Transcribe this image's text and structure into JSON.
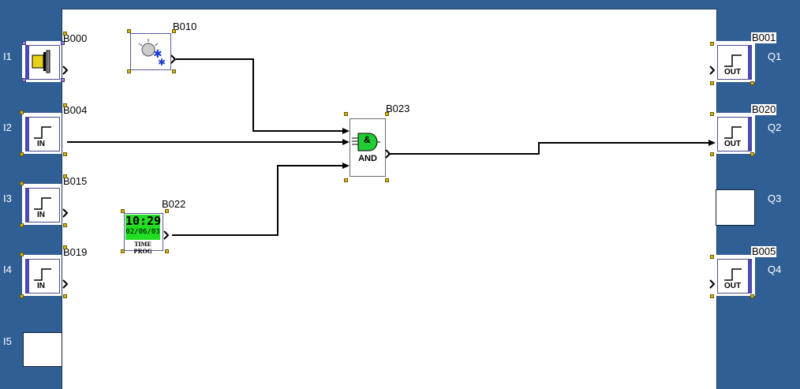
{
  "inputs": [
    {
      "label": "I1",
      "block_id": "B000",
      "symbol": "pushbutton-icon"
    },
    {
      "label": "I2",
      "block_id": "B004",
      "symbol_text": "IN"
    },
    {
      "label": "I3",
      "block_id": "B015",
      "symbol_text": "IN"
    },
    {
      "label": "I4",
      "block_id": "B019",
      "symbol_text": "IN"
    },
    {
      "label": "I5",
      "block_id": ""
    }
  ],
  "outputs": [
    {
      "label": "Q1",
      "block_id": "B001",
      "symbol_text": "OUT"
    },
    {
      "label": "Q2",
      "block_id": "B020",
      "symbol_text": "OUT"
    },
    {
      "label": "Q3",
      "block_id": ""
    },
    {
      "label": "Q4",
      "block_id": "B005",
      "symbol_text": "OUT"
    }
  ],
  "blocks": {
    "b010": {
      "block_id": "B010",
      "symbol": "light-sensor-icon"
    },
    "b022": {
      "block_id": "B022",
      "time": "10:29",
      "date": "02/06/03",
      "caption": "TIME PROG"
    },
    "b023": {
      "block_id": "B023",
      "caption": "AND",
      "symbol_text": "&"
    }
  },
  "colors": {
    "background": "#2f5f95",
    "canvas": "#ffffff",
    "handle": "#d8b21a",
    "and_gate": "#22cc33",
    "lcd": "#22dd22"
  }
}
